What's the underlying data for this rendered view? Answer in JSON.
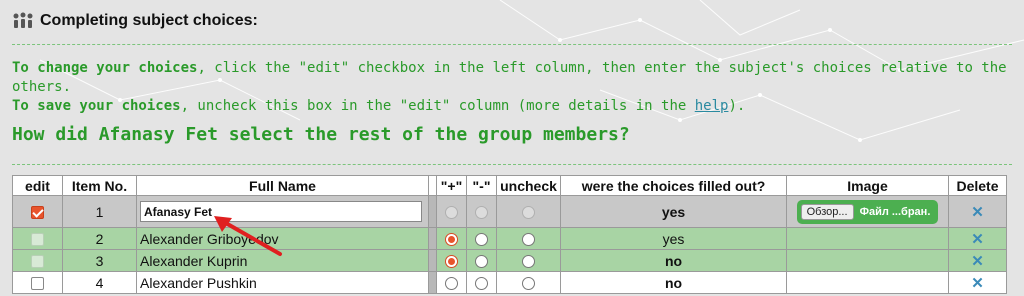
{
  "header": {
    "icon": "group-people-icon",
    "title": "Completing subject choices:"
  },
  "instructions": {
    "change_bold": "To change your choices",
    "change_rest": ", click the \"edit\" checkbox in the left column, then enter the subject's choices relative to the others.",
    "save_bold": "To save your choices",
    "save_rest": ", uncheck this box in the \"edit\" column (more details in the ",
    "help_link": "help",
    "save_end": ")."
  },
  "question": "How did Afanasy Fet select the rest of the group members?",
  "table": {
    "headers": {
      "edit": "edit",
      "item_no": "Item No.",
      "full_name": "Full Name",
      "plus": "\"+\"",
      "minus": "\"-\"",
      "uncheck": "uncheck",
      "filled": "were the choices filled out?",
      "image": "Image",
      "delete": "Delete"
    },
    "rows": [
      {
        "item_no": "1",
        "full_name": "Afanasy Fet",
        "filled": "yes"
      },
      {
        "item_no": "2",
        "full_name": "Alexander Griboyedov",
        "filled": "yes"
      },
      {
        "item_no": "3",
        "full_name": "Alexander Kuprin",
        "filled": "no"
      },
      {
        "item_no": "4",
        "full_name": "Alexander Pushkin",
        "filled": "no"
      }
    ],
    "file_button": "Обзор...",
    "file_label": "Файл ...бран.",
    "delete_glyph": "✕"
  },
  "colors": {
    "accent_green": "#2a9a2a",
    "checkbox_orange": "#e8542c",
    "arrow_red": "#e02020"
  }
}
